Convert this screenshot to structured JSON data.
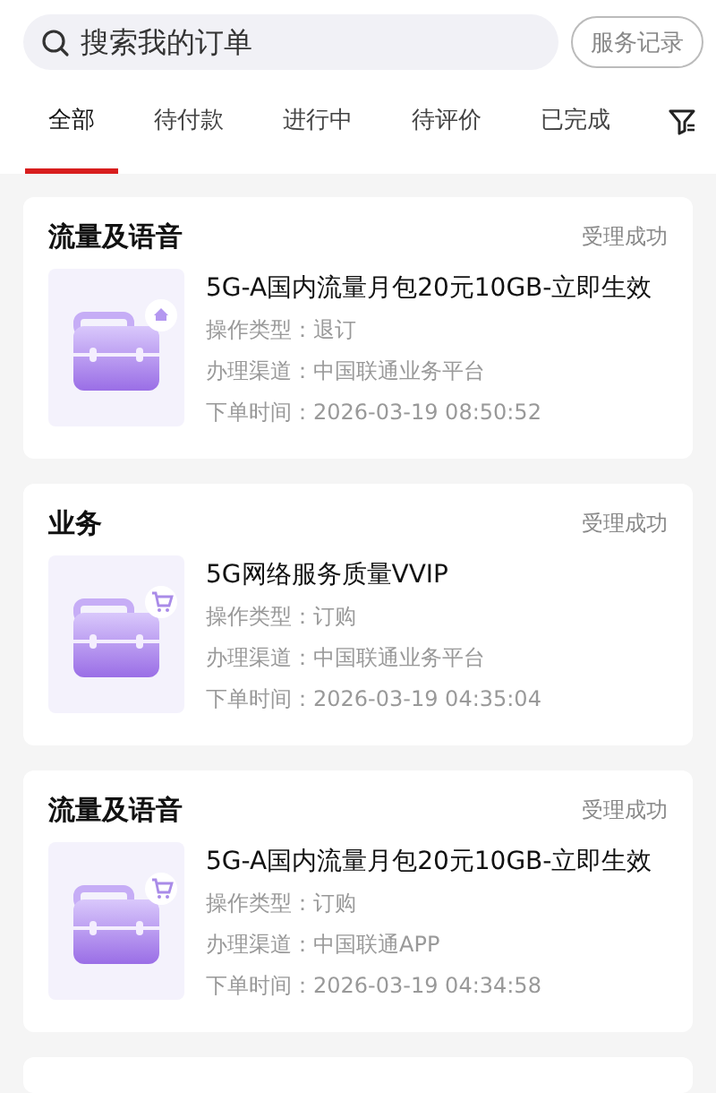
{
  "search": {
    "placeholder": "搜索我的订单"
  },
  "records_button": "服务记录",
  "tabs": [
    {
      "label": "全部",
      "selected": true
    },
    {
      "label": "待付款",
      "selected": false
    },
    {
      "label": "进行中",
      "selected": false
    },
    {
      "label": "待评价",
      "selected": false
    },
    {
      "label": "已完成",
      "selected": false
    }
  ],
  "orders": [
    {
      "category": "流量及语音",
      "status": "受理成功",
      "kind": "unsubscribe",
      "title": "5G-A国内流量月包20元10GB-立即生效",
      "details": [
        "操作类型：退订",
        "办理渠道：中国联通业务平台",
        "下单时间：2026-03-19 08:50:52"
      ]
    },
    {
      "category": "业务",
      "status": "受理成功",
      "kind": "subscribe",
      "title": "5G网络服务质量VVIP",
      "details": [
        "操作类型：订购",
        "办理渠道：中国联通业务平台",
        "下单时间：2026-03-19 04:35:04"
      ]
    },
    {
      "category": "流量及语音",
      "status": "受理成功",
      "kind": "subscribe",
      "title": "5G-A国内流量月包20元10GB-立即生效",
      "details": [
        "操作类型：订购",
        "办理渠道：中国联通APP",
        "下单时间：2026-03-19 04:34:58"
      ]
    }
  ]
}
